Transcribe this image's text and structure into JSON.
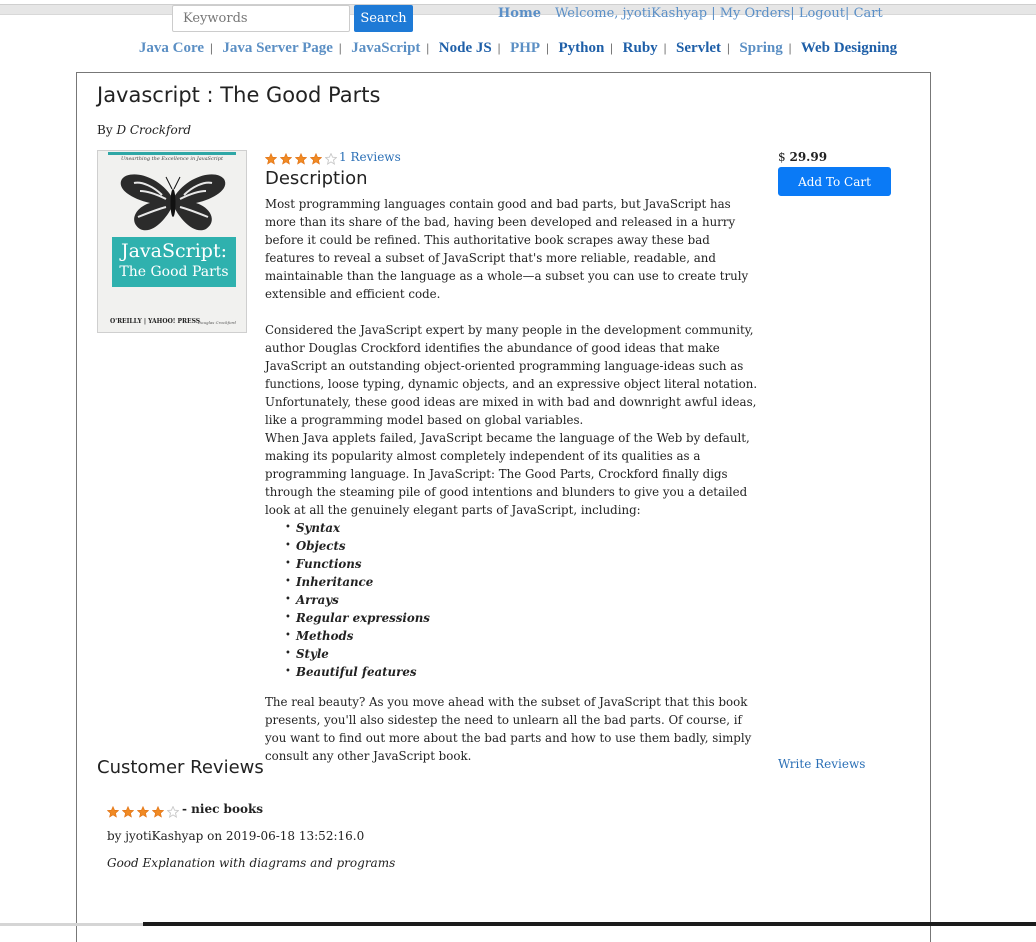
{
  "search": {
    "placeholder": "Keywords",
    "button_label": "Search"
  },
  "header": {
    "home": "Home",
    "welcome": "Welcome, jyotiKashyap",
    "sep1": "|",
    "my_orders": "My Orders",
    "sep2": "|",
    "logout": "Logout",
    "sep3": "|",
    "cart": "Cart"
  },
  "nav": {
    "separator": "|",
    "items": [
      {
        "label": "Java Core",
        "color": "#5b8fc4"
      },
      {
        "label": "Java Server Page",
        "color": "#5b8fc4"
      },
      {
        "label": "JavaScript",
        "color": "#5b8fc4"
      },
      {
        "label": "Node JS",
        "color": "#1e5fa8"
      },
      {
        "label": "PHP",
        "color": "#5b8fc4"
      },
      {
        "label": "Python",
        "color": "#1e5fa8"
      },
      {
        "label": "Ruby",
        "color": "#1e5fa8"
      },
      {
        "label": "Servlet",
        "color": "#1e5fa8"
      },
      {
        "label": "Spring",
        "color": "#5b8fc4"
      },
      {
        "label": "Web Designing",
        "color": "#1e5fa8"
      }
    ]
  },
  "book": {
    "title": "Javascript : The Good Parts",
    "by_label": "By",
    "author": "D Crockford",
    "cover": {
      "tagline": "Unearthing the Excellence in JavaScript",
      "title_line1": "JavaScript:",
      "title_line2": "The Good Parts",
      "publisher": "O'REILLY  |  YAHOO! PRESS",
      "author": "Douglas Crockford"
    },
    "rating": 4,
    "rating_max": 5,
    "reviews_link": "1 Reviews",
    "price_symbol": "$",
    "price": "29.99",
    "add_to_cart": "Add To Cart"
  },
  "description": {
    "heading": "Description",
    "para1": "Most programming languages contain good and bad parts, but JavaScript has more than its share of the bad, having been developed and released in a hurry before it could be refined. This authoritative book scrapes away these bad features to reveal a subset of JavaScript that's more reliable, readable, and maintainable than the language as a whole—a subset you can use to create truly extensible and efficient code.",
    "para2": "Considered the JavaScript expert by many people in the development community, author Douglas Crockford identifies the abundance of good ideas that make JavaScript an outstanding object-oriented programming language-ideas such as functions, loose typing, dynamic objects, and an expressive object literal notation. Unfortunately, these good ideas are mixed in with bad and downright awful ideas, like a programming model based on global variables.",
    "para3": "When Java applets failed, JavaScript became the language of the Web by default, making its popularity almost completely independent of its qualities as a programming language. In JavaScript: The Good Parts, Crockford finally digs through the steaming pile of good intentions and blunders to give you a detailed look at all the genuinely elegant parts of JavaScript, including:",
    "list": [
      "Syntax",
      "Objects",
      "Functions",
      "Inheritance",
      "Arrays",
      "Regular expressions",
      "Methods",
      "Style",
      "Beautiful features"
    ],
    "para4": "The real beauty? As you move ahead with the subset of JavaScript that this book presents, you'll also sidestep the need to unlearn all the bad parts. Of course, if you want to find out more about the bad parts and how to use them badly, simply consult any other JavaScript book."
  },
  "reviews": {
    "heading": "Customer Reviews",
    "write_label": "Write Reviews",
    "items": [
      {
        "rating": 4,
        "title": "- niec books",
        "meta": "by jyotiKashyap on 2019-06-18 13:52:16.0",
        "text": "Good Explanation with diagrams and programs"
      }
    ]
  },
  "colors": {
    "star_filled": "#f08a24",
    "star_empty": "#c8c8c8",
    "link": "#2a6fb6",
    "button": "#0a7af6"
  }
}
